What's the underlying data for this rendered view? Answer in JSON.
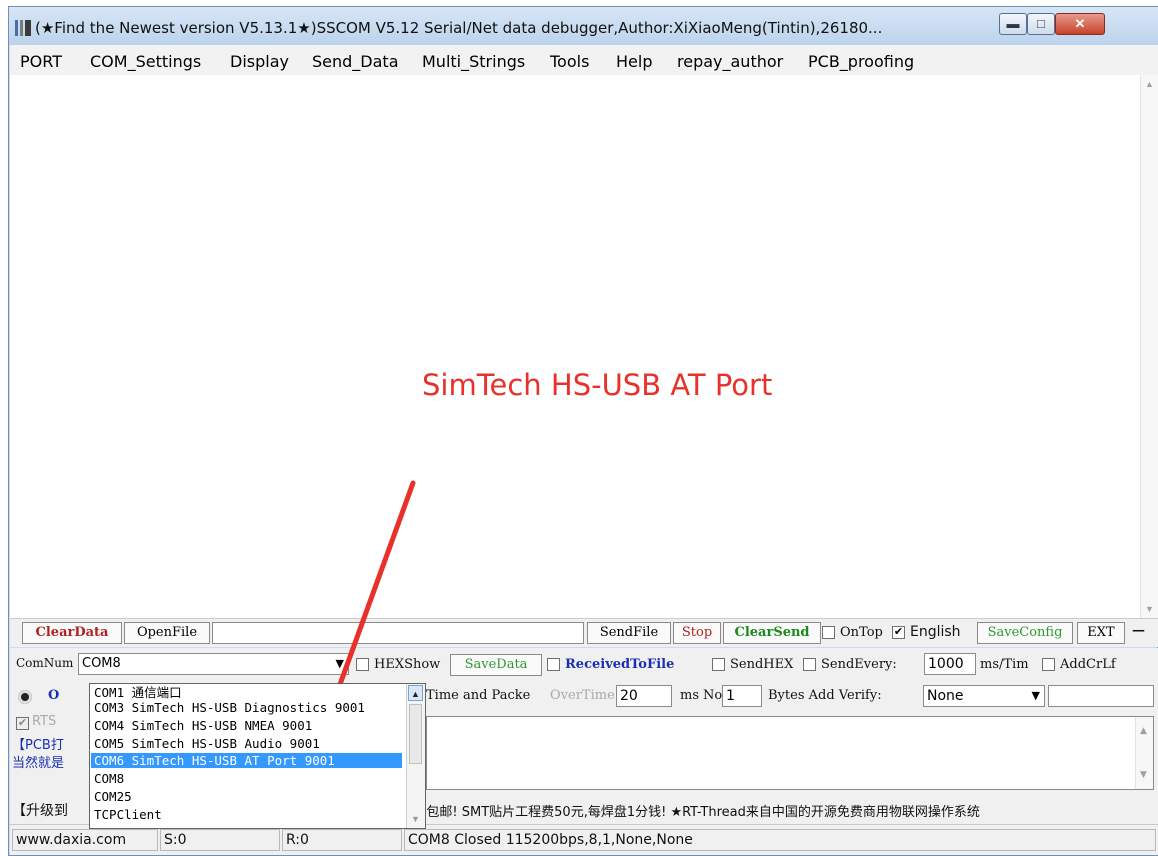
{
  "window": {
    "title": "(★Find the Newest version V5.13.1★)SSCOM V5.12 Serial/Net data debugger,Author:XiXiaoMeng(Tintin),26180...",
    "icon": "app-icon",
    "controls": {
      "minimize": "▬",
      "maximize": "□",
      "close": "✕"
    }
  },
  "menu": [
    "PORT",
    "COM_Settings",
    "Display",
    "Send_Data",
    "Multi_Strings",
    "Tools",
    "Help",
    "repay_author",
    "PCB_proofing"
  ],
  "annotation": {
    "text": "SimTech HS-USB AT Port",
    "color": "#e8312b"
  },
  "toolbar1": {
    "clear_data": "ClearData",
    "open_file": "OpenFile",
    "file_path": "",
    "send_file": "SendFile",
    "stop": "Stop",
    "clear_send": "ClearSend",
    "on_top": "OnTop",
    "on_top_checked": false,
    "english": "English",
    "english_checked": true,
    "save_config": "SaveConfig",
    "ext": "EXT",
    "dash": "—"
  },
  "toolbar2": {
    "com_num_label": "ComNum",
    "com_value": "COM8",
    "hex_show": "HEXShow",
    "save_data": "SaveData",
    "received_to_file": "ReceivedToFile",
    "send_hex": "SendHEX",
    "send_every": "SendEvery:",
    "send_every_value": "1000",
    "ms_tim": "ms/Tim",
    "add_crlf": "AddCrLf"
  },
  "toolbar3": {
    "time_and_packet": "Time and Packe",
    "overtime_label": "OverTime:",
    "overtime_value": "20",
    "ms": "ms",
    "no_label": "No",
    "no_value": "1",
    "bytes_add_verify": "Bytes Add Verify:",
    "verify_value": "None"
  },
  "left_partial": {
    "open_btn": "O",
    "rts": "RTS",
    "pcb_ad": "【PCB打",
    "pcb_ad2": "当然就是",
    "upgrade": "【升级到"
  },
  "com_dropdown": {
    "items": [
      "COM1 通信端口",
      "COM3 SimTech HS-USB Diagnostics 9001",
      "COM4 SimTech HS-USB NMEA 9001",
      "COM5 SimTech HS-USB Audio 9001",
      "COM6 SimTech HS-USB AT Port 9001",
      "COM8",
      "COM25",
      "TCPClient"
    ],
    "selected_index": 4
  },
  "ticker": "...包邮! SMT贴片工程费50元,每焊盘1分钱! ★RT-Thread来自中国的开源免费商用物联网操作系统",
  "status": {
    "website": "www.daxia.com",
    "sent": "S:0",
    "received": "R:0",
    "port_status": "COM8 Closed  115200bps,8,1,None,None"
  }
}
